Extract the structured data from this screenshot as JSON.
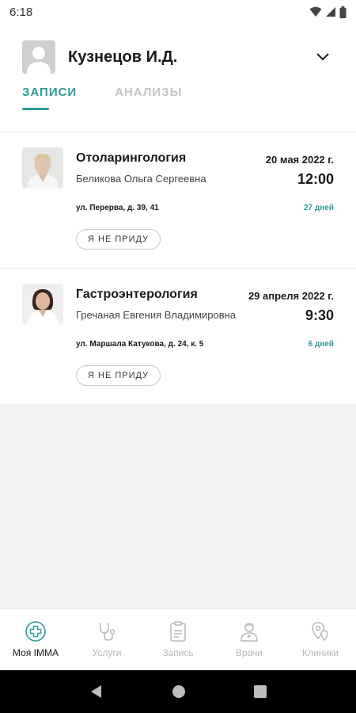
{
  "status_bar": {
    "time": "6:18"
  },
  "profile": {
    "name": "Кузнецов И.Д."
  },
  "tabs": [
    {
      "label": "Записи",
      "active": true
    },
    {
      "label": "Анализы",
      "active": false
    }
  ],
  "appointments": [
    {
      "specialty": "Отоларингология",
      "doctor": "Беликова Ольга Сергеевна",
      "date": "20 мая 2022 г.",
      "time": "12:00",
      "address": "ул. Перерва, д. 39, 41",
      "days_left": "27 дней",
      "cancel_label": "Я НЕ ПРИДУ"
    },
    {
      "specialty": "Гастроэнтерология",
      "doctor": "Гречаная Евгения Владимировна",
      "date": "29 апреля 2022 г.",
      "time": "9:30",
      "address": "ул. Маршала Катукова, д. 24, к. 5",
      "days_left": "6 дней",
      "cancel_label": "Я НЕ ПРИДУ"
    }
  ],
  "bottom_nav": [
    {
      "label": "Моя IMMA",
      "icon": "medical-cross-icon",
      "active": true
    },
    {
      "label": "Услуги",
      "icon": "stethoscope-icon",
      "active": false
    },
    {
      "label": "Запись",
      "icon": "clipboard-icon",
      "active": false
    },
    {
      "label": "Врачи",
      "icon": "doctor-icon",
      "active": false
    },
    {
      "label": "Клиники",
      "icon": "map-pin-icon",
      "active": false
    }
  ],
  "colors": {
    "accent": "#2e9c96",
    "inactive": "#b8b8b8",
    "background_empty": "#f2f2f2"
  }
}
